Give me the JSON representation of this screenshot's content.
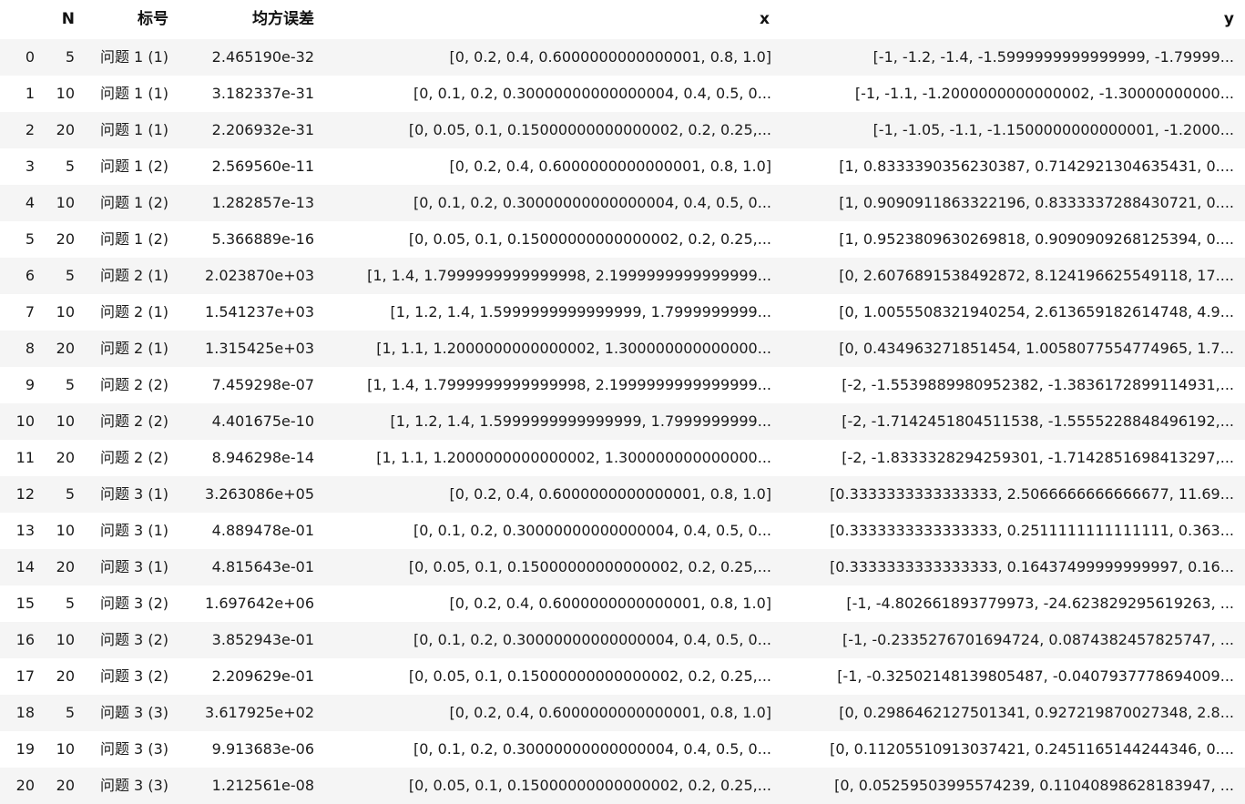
{
  "table": {
    "columns": [
      "",
      "N",
      "标号",
      "均方误差",
      "x",
      "y"
    ],
    "rows": [
      {
        "index": "0",
        "n": "5",
        "label": "问题 1 (1)",
        "mse": "2.465190e-32",
        "x": "[0, 0.2, 0.4, 0.6000000000000001, 0.8, 1.0]",
        "y": "[-1, -1.2, -1.4, -1.5999999999999999, -1.79999..."
      },
      {
        "index": "1",
        "n": "10",
        "label": "问题 1 (1)",
        "mse": "3.182337e-31",
        "x": "[0, 0.1, 0.2, 0.30000000000000004, 0.4, 0.5, 0...",
        "y": "[-1, -1.1, -1.2000000000000002, -1.30000000000..."
      },
      {
        "index": "2",
        "n": "20",
        "label": "问题 1 (1)",
        "mse": "2.206932e-31",
        "x": "[0, 0.05, 0.1, 0.15000000000000002, 0.2, 0.25,...",
        "y": "[-1, -1.05, -1.1, -1.1500000000000001, -1.2000..."
      },
      {
        "index": "3",
        "n": "5",
        "label": "问题 1 (2)",
        "mse": "2.569560e-11",
        "x": "[0, 0.2, 0.4, 0.6000000000000001, 0.8, 1.0]",
        "y": "[1, 0.8333390356230387, 0.7142921304635431, 0...."
      },
      {
        "index": "4",
        "n": "10",
        "label": "问题 1 (2)",
        "mse": "1.282857e-13",
        "x": "[0, 0.1, 0.2, 0.30000000000000004, 0.4, 0.5, 0...",
        "y": "[1, 0.9090911863322196, 0.8333337288430721, 0...."
      },
      {
        "index": "5",
        "n": "20",
        "label": "问题 1 (2)",
        "mse": "5.366889e-16",
        "x": "[0, 0.05, 0.1, 0.15000000000000002, 0.2, 0.25,...",
        "y": "[1, 0.9523809630269818, 0.9090909268125394, 0...."
      },
      {
        "index": "6",
        "n": "5",
        "label": "问题 2 (1)",
        "mse": "2.023870e+03",
        "x": "[1, 1.4, 1.7999999999999998, 2.1999999999999999...",
        "y": "[0, 2.6076891538492872, 8.124196625549118, 17...."
      },
      {
        "index": "7",
        "n": "10",
        "label": "问题 2 (1)",
        "mse": "1.541237e+03",
        "x": "[1, 1.2, 1.4, 1.5999999999999999, 1.7999999999...",
        "y": "[0, 1.0055508321940254, 2.613659182614748, 4.9..."
      },
      {
        "index": "8",
        "n": "20",
        "label": "问题 2 (1)",
        "mse": "1.315425e+03",
        "x": "[1, 1.1, 1.2000000000000002, 1.300000000000000...",
        "y": "[0, 0.434963271851454, 1.0058077554774965, 1.7..."
      },
      {
        "index": "9",
        "n": "5",
        "label": "问题 2 (2)",
        "mse": "7.459298e-07",
        "x": "[1, 1.4, 1.7999999999999998, 2.1999999999999999...",
        "y": "[-2, -1.5539889980952382, -1.3836172899114931,..."
      },
      {
        "index": "10",
        "n": "10",
        "label": "问题 2 (2)",
        "mse": "4.401675e-10",
        "x": "[1, 1.2, 1.4, 1.5999999999999999, 1.7999999999...",
        "y": "[-2, -1.7142451804511538, -1.5555228848496192,..."
      },
      {
        "index": "11",
        "n": "20",
        "label": "问题 2 (2)",
        "mse": "8.946298e-14",
        "x": "[1, 1.1, 1.2000000000000002, 1.300000000000000...",
        "y": "[-2, -1.8333328294259301, -1.7142851698413297,..."
      },
      {
        "index": "12",
        "n": "5",
        "label": "问题 3 (1)",
        "mse": "3.263086e+05",
        "x": "[0, 0.2, 0.4, 0.6000000000000001, 0.8, 1.0]",
        "y": "[0.3333333333333333, 2.5066666666666677, 11.69..."
      },
      {
        "index": "13",
        "n": "10",
        "label": "问题 3 (1)",
        "mse": "4.889478e-01",
        "x": "[0, 0.1, 0.2, 0.30000000000000004, 0.4, 0.5, 0...",
        "y": "[0.3333333333333333, 0.2511111111111111, 0.363..."
      },
      {
        "index": "14",
        "n": "20",
        "label": "问题 3 (1)",
        "mse": "4.815643e-01",
        "x": "[0, 0.05, 0.1, 0.15000000000000002, 0.2, 0.25,...",
        "y": "[0.3333333333333333, 0.16437499999999997, 0.16..."
      },
      {
        "index": "15",
        "n": "5",
        "label": "问题 3 (2)",
        "mse": "1.697642e+06",
        "x": "[0, 0.2, 0.4, 0.6000000000000001, 0.8, 1.0]",
        "y": "[-1, -4.802661893779973, -24.623829295619263, ..."
      },
      {
        "index": "16",
        "n": "10",
        "label": "问题 3 (2)",
        "mse": "3.852943e-01",
        "x": "[0, 0.1, 0.2, 0.30000000000000004, 0.4, 0.5, 0...",
        "y": "[-1, -0.2335276701694724, 0.0874382457825747, ..."
      },
      {
        "index": "17",
        "n": "20",
        "label": "问题 3 (2)",
        "mse": "2.209629e-01",
        "x": "[0, 0.05, 0.1, 0.15000000000000002, 0.2, 0.25,...",
        "y": "[-1, -0.32502148139805487, -0.0407937778694009..."
      },
      {
        "index": "18",
        "n": "5",
        "label": "问题 3 (3)",
        "mse": "3.617925e+02",
        "x": "[0, 0.2, 0.4, 0.6000000000000001, 0.8, 1.0]",
        "y": "[0, 0.2986462127501341, 0.927219870027348, 2.8..."
      },
      {
        "index": "19",
        "n": "10",
        "label": "问题 3 (3)",
        "mse": "9.913683e-06",
        "x": "[0, 0.1, 0.2, 0.30000000000000004, 0.4, 0.5, 0...",
        "y": "[0, 0.11205510913037421, 0.2451165144244346, 0...."
      },
      {
        "index": "20",
        "n": "20",
        "label": "问题 3 (3)",
        "mse": "1.212561e-08",
        "x": "[0, 0.05, 0.1, 0.15000000000000002, 0.2, 0.25,...",
        "y": "[0, 0.05259503995574239, 0.11040898628183947, ..."
      }
    ]
  }
}
